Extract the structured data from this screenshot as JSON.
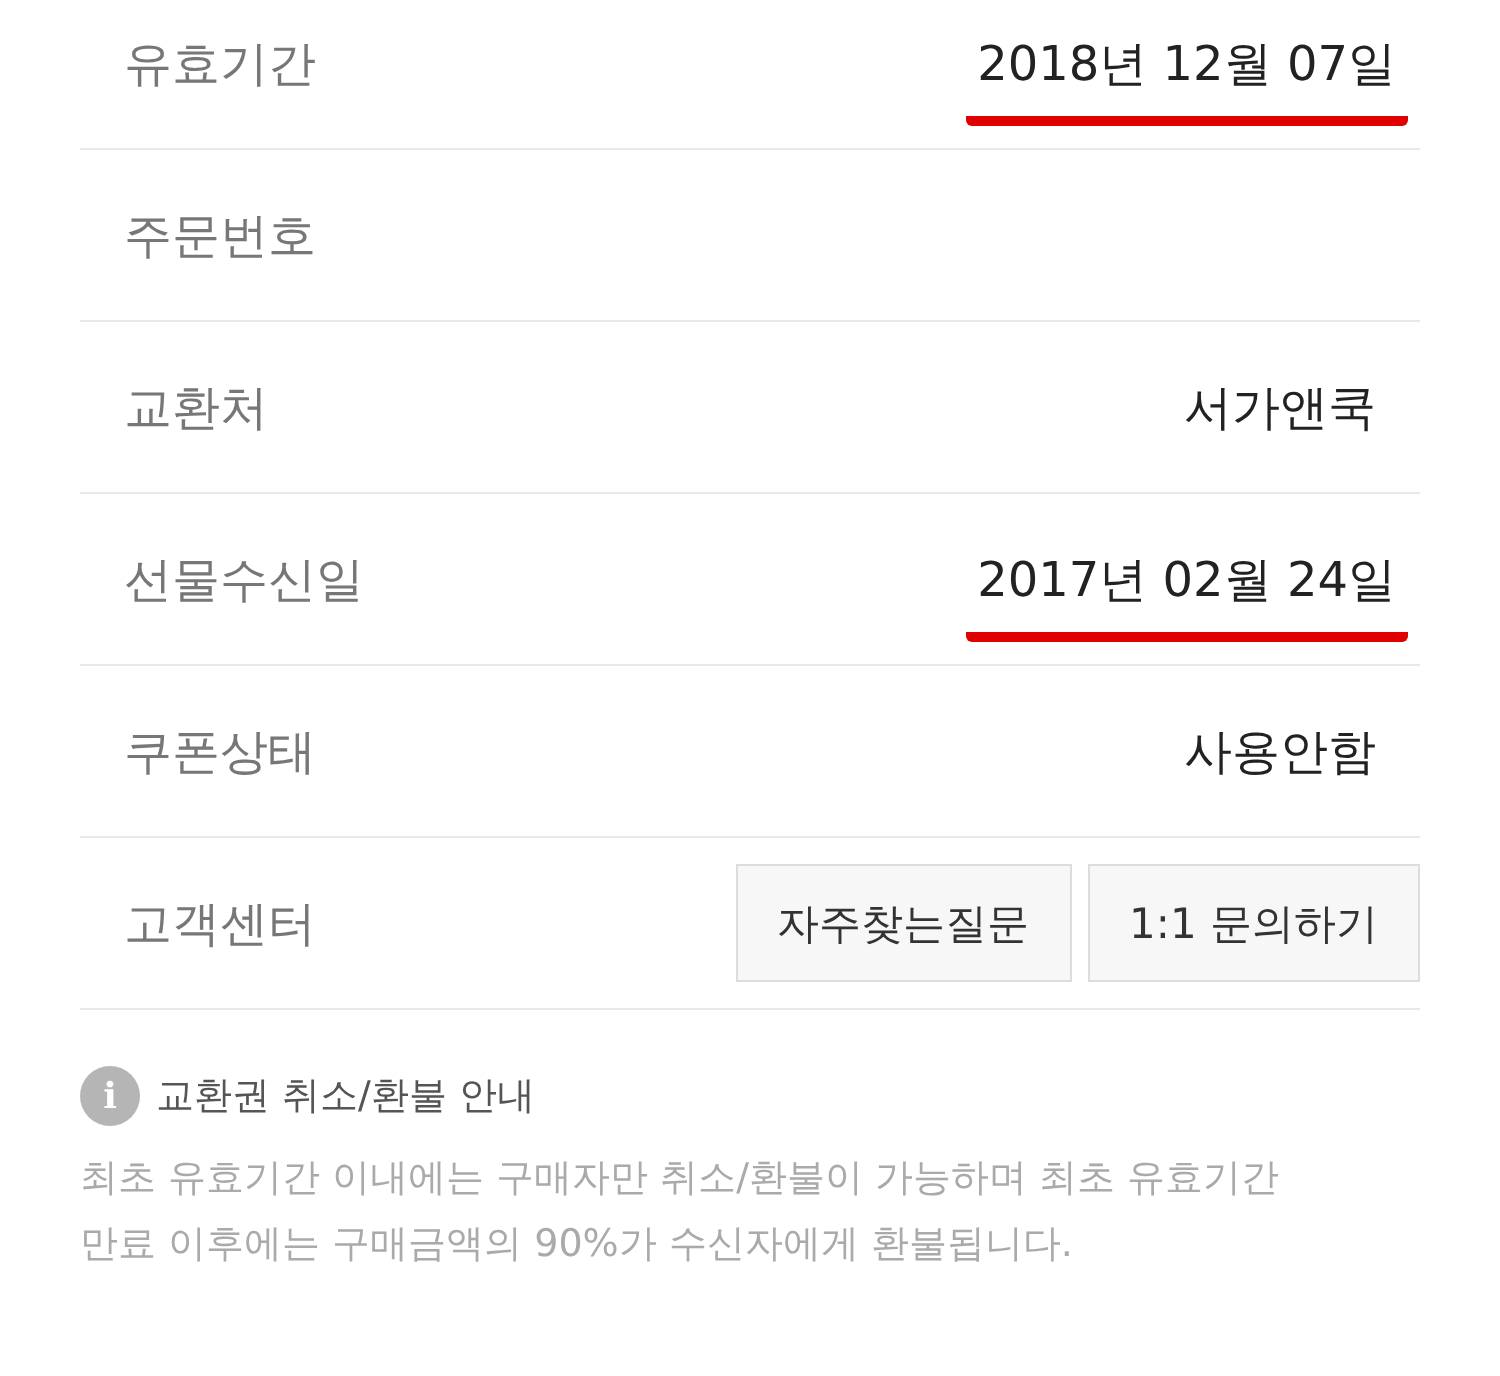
{
  "rows": [
    {
      "kind": "text",
      "label": "유효기간",
      "value": "2018년 12월 07일",
      "marked": true
    },
    {
      "kind": "text",
      "label": "주문번호"
    },
    {
      "kind": "text",
      "label": "교환처",
      "value": "서가앤쿡",
      "marked": false
    },
    {
      "kind": "text",
      "label": "선물수신일",
      "value": "2017년 02월 24일",
      "marked": true
    },
    {
      "kind": "text",
      "label": "쿠폰상태",
      "value": "사용안함",
      "marked": false
    },
    {
      "kind": "buttons",
      "label": "고객센터",
      "buttons": [
        "자주찾는질문",
        "1:1 문의하기"
      ]
    }
  ],
  "notice": {
    "icon": "i",
    "title": "교환권 취소/환불 안내",
    "text": "최초 유효기간 이내에는 구매자만 취소/환불이 가능하며 최초 유효기간 만료 이후에는 구매금액의 90%가 수신자에게 환불됩니다."
  }
}
